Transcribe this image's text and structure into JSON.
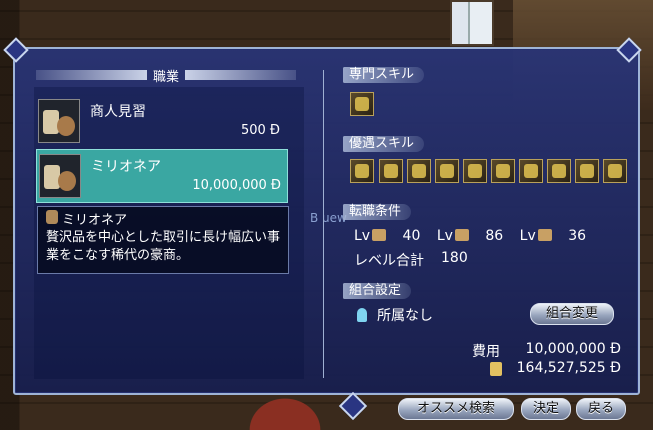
{
  "job_section": {
    "title": "職業",
    "jobs": [
      {
        "name": "商人見習",
        "price": "500 Ɖ"
      },
      {
        "name": "ミリオネア",
        "price": "10,000,000 Ɖ"
      }
    ]
  },
  "tooltip": {
    "title": "ミリオネア",
    "desc": "贅沢品を中心とした取引に長け幅広い事業をこなす稀代の豪商。"
  },
  "skills": {
    "specialty_label": "専門スキル",
    "preferred_label": "優遇スキル",
    "preferred_icons": [
      "skill-1-icon",
      "skill-2-icon",
      "skill-3-icon",
      "skill-4-icon",
      "skill-5-icon",
      "skill-6-icon",
      "skill-7-icon",
      "skill-8-icon",
      "skill-9-icon",
      "skill-10-icon"
    ]
  },
  "conditions": {
    "label": "転職条件",
    "lv_prefix": "Lv",
    "adventure_lv": "40",
    "trade_lv": "86",
    "battle_lv": "36",
    "total_label": "レベル合計",
    "total_value": "180"
  },
  "guild": {
    "label": "組合設定",
    "status": "所属なし",
    "change_button": "組合変更"
  },
  "cost": {
    "label": "費用",
    "value": "10,000,000 Ɖ",
    "money": "164,527,525 Ɖ"
  },
  "background_text": "B uew",
  "buttons": {
    "recommend": "オススメ検索",
    "confirm": "決定",
    "back": "戻る"
  }
}
